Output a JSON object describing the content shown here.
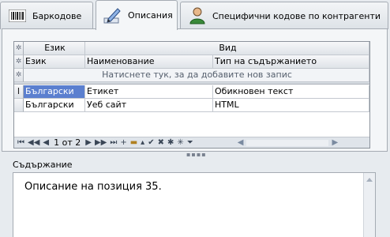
{
  "tabs": [
    {
      "label": "Баркодове",
      "icon": "barcode-icon",
      "active": false
    },
    {
      "label": "Описания",
      "icon": "pen-edit-icon",
      "active": true
    },
    {
      "label": "Специфични кодове по контрагенти",
      "icon": "person-icon",
      "active": false
    }
  ],
  "grid": {
    "band_headers": [
      "Език",
      "Вид"
    ],
    "columns": [
      "Език",
      "Наименование",
      "Тип на съдържанието"
    ],
    "new_row_prompt": "Натиснете тук, за да добавите нов запис",
    "rows": [
      [
        "Български",
        "Етикет",
        "Обикновен текст"
      ],
      [
        "Български",
        "Уеб сайт",
        "HTML"
      ]
    ],
    "selected_row": 0
  },
  "navigator": {
    "position": "1 от 2"
  },
  "content": {
    "label": "Съдържание",
    "text": "Описание на позиция 35."
  },
  "colors": {
    "selection": "#5b7fcf",
    "background": "#e7ebef"
  }
}
